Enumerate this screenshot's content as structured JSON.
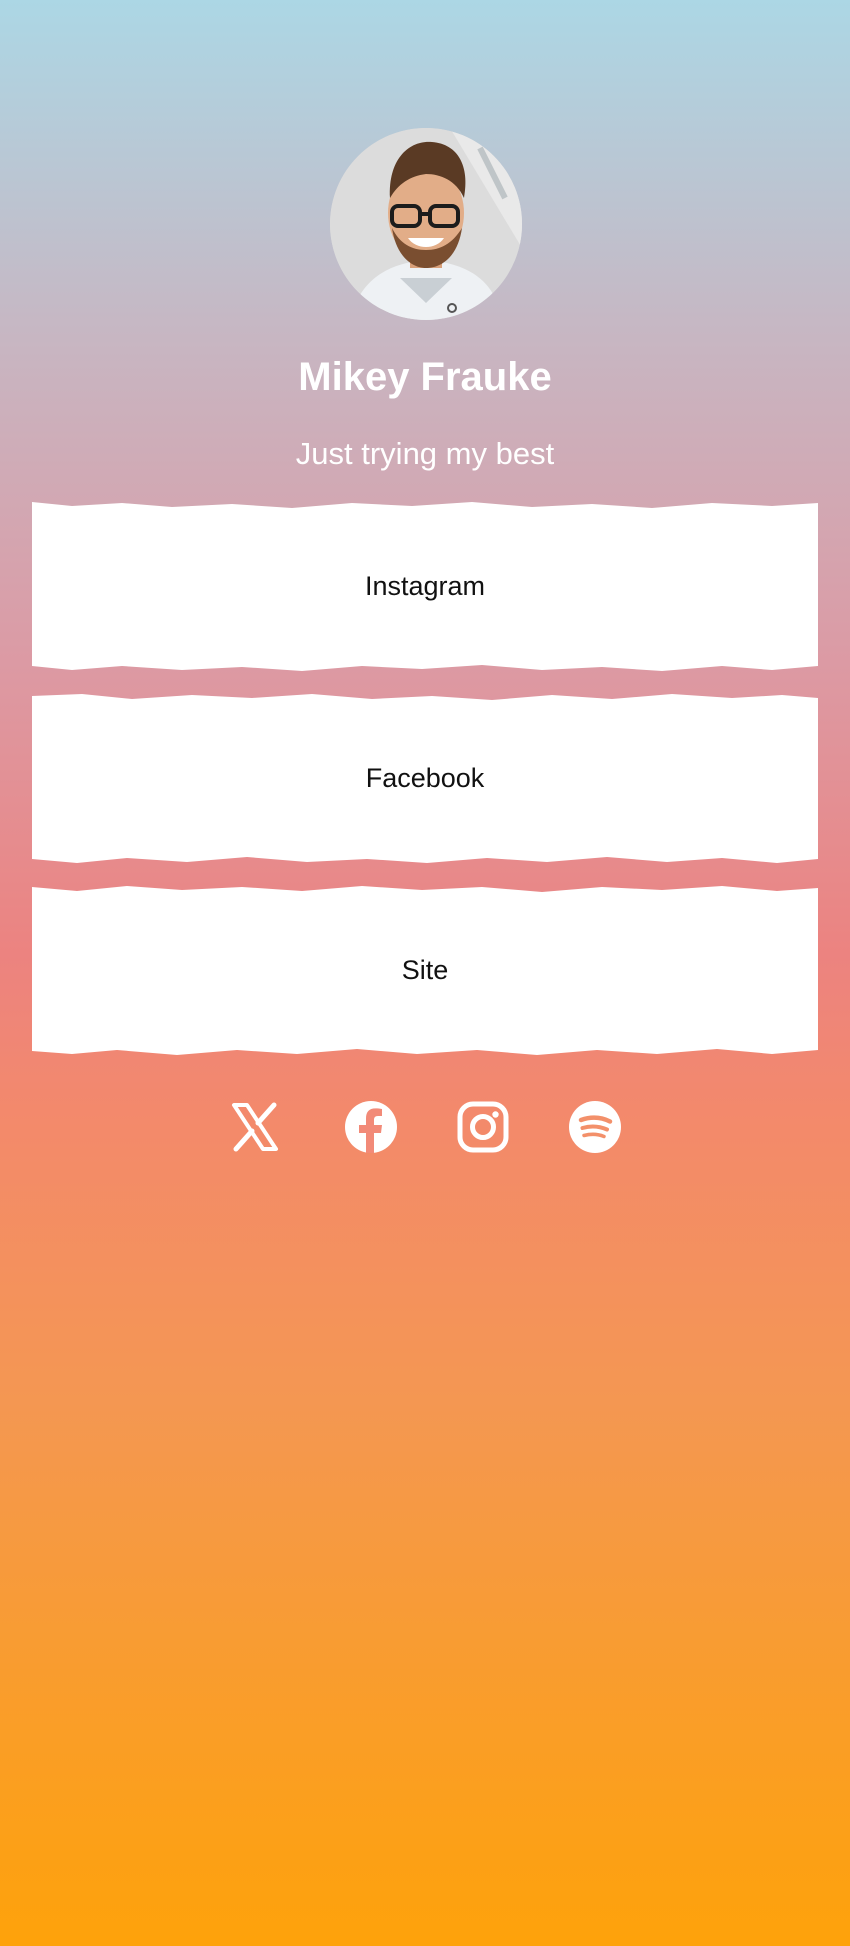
{
  "profile": {
    "name": "Mikey Frauke",
    "bio": "Just trying my best",
    "avatar_alt": "profile photo"
  },
  "links": [
    {
      "label": "Instagram"
    },
    {
      "label": "Facebook"
    },
    {
      "label": "Site"
    }
  ],
  "socials": [
    {
      "name": "x-icon"
    },
    {
      "name": "facebook-icon"
    },
    {
      "name": "instagram-icon"
    },
    {
      "name": "spotify-icon"
    }
  ],
  "colors": {
    "gradient_top": "#acd7e5",
    "gradient_mid": "#ec8380",
    "gradient_bottom": "#fea20a",
    "card": "#ffffff",
    "text_light": "#ffffff",
    "text_dark": "#111111"
  }
}
